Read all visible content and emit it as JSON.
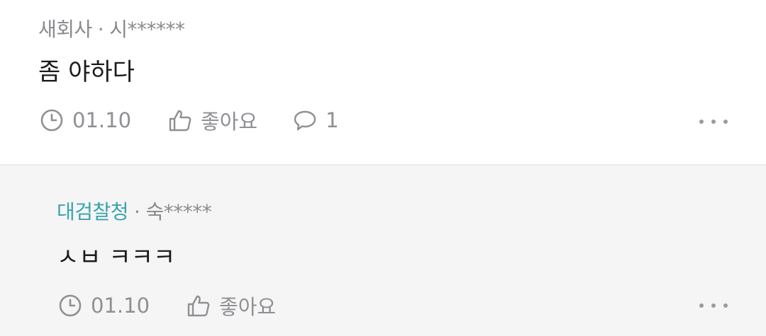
{
  "comments": [
    {
      "author": "새회사",
      "separator": "·",
      "user_id": "시******",
      "text": "좀 야하다",
      "date": "01.10",
      "like_label": "좋아요",
      "reply_count": "1"
    },
    {
      "author": "대검찰청",
      "author_color": "#3aa3ad",
      "separator": "·",
      "user_id": "숙*****",
      "text": "ㅅㅂ ㅋㅋㅋ",
      "date": "01.10",
      "like_label": "좋아요"
    }
  ]
}
